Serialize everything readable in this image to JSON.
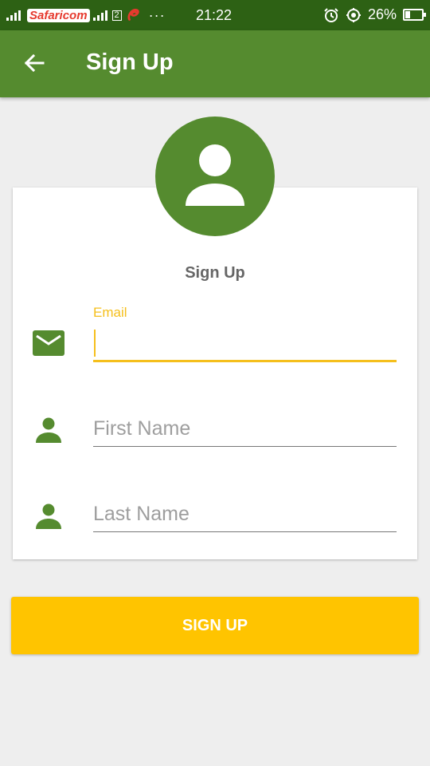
{
  "status_bar": {
    "carrier": "Safaricom",
    "sim_slot": "2",
    "overflow": "···",
    "time": "21:22",
    "battery": "26%",
    "battery_level": 0.26,
    "icons": [
      "signal-icon",
      "alarm-icon",
      "location-icon",
      "battery-icon"
    ]
  },
  "app_bar": {
    "title": "Sign Up",
    "back_icon": "arrow-left-icon",
    "color": "#558b2f"
  },
  "form": {
    "title": "Sign Up",
    "avatar_icon": "person-icon",
    "fields": [
      {
        "icon": "email-icon",
        "label": "Email",
        "value": "",
        "focused": true
      },
      {
        "icon": "person-icon",
        "placeholder": "First Name",
        "value": ""
      },
      {
        "icon": "person-icon",
        "placeholder": "Last Name",
        "value": ""
      }
    ]
  },
  "signup_button": {
    "label": "SIGN UP",
    "color": "#ffc400"
  },
  "colors": {
    "primary": "#558b2f",
    "accent": "#f5bf1c",
    "status_bar": "#2d6114",
    "background": "#eeeeee"
  }
}
